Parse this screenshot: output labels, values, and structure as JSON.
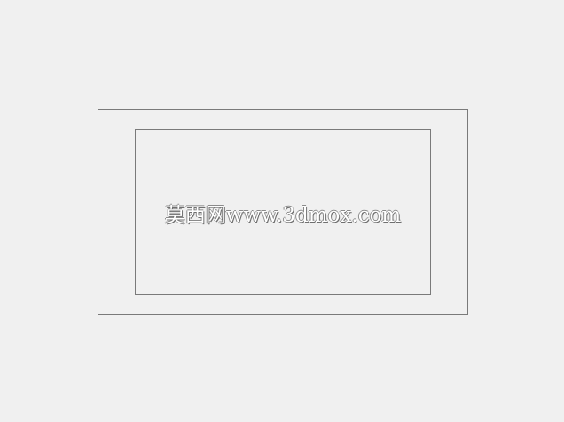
{
  "watermark": {
    "text": "莫西网www.3dmox.com"
  },
  "colors": {
    "background": "#f0f0f0",
    "frame_border": "#7a7a7a",
    "watermark_fill": "#ffffff",
    "watermark_shadow": "#6f6f6f"
  }
}
